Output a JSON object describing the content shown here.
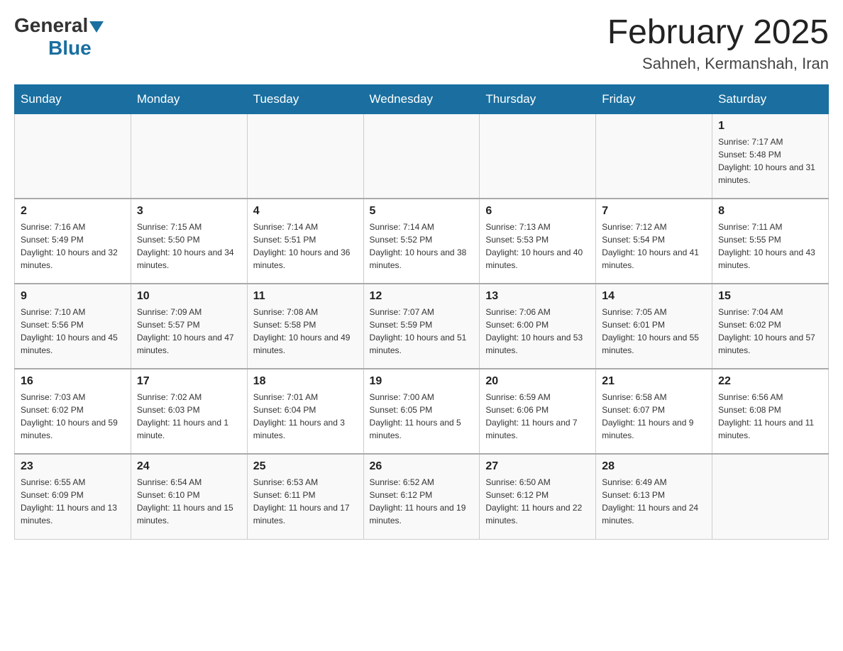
{
  "header": {
    "logo_general": "General",
    "logo_blue": "Blue",
    "month": "February 2025",
    "location": "Sahneh, Kermanshah, Iran"
  },
  "days_of_week": [
    "Sunday",
    "Monday",
    "Tuesday",
    "Wednesday",
    "Thursday",
    "Friday",
    "Saturday"
  ],
  "weeks": [
    [
      {
        "day": "",
        "sunrise": "",
        "sunset": "",
        "daylight": ""
      },
      {
        "day": "",
        "sunrise": "",
        "sunset": "",
        "daylight": ""
      },
      {
        "day": "",
        "sunrise": "",
        "sunset": "",
        "daylight": ""
      },
      {
        "day": "",
        "sunrise": "",
        "sunset": "",
        "daylight": ""
      },
      {
        "day": "",
        "sunrise": "",
        "sunset": "",
        "daylight": ""
      },
      {
        "day": "",
        "sunrise": "",
        "sunset": "",
        "daylight": ""
      },
      {
        "day": "1",
        "sunrise": "Sunrise: 7:17 AM",
        "sunset": "Sunset: 5:48 PM",
        "daylight": "Daylight: 10 hours and 31 minutes."
      }
    ],
    [
      {
        "day": "2",
        "sunrise": "Sunrise: 7:16 AM",
        "sunset": "Sunset: 5:49 PM",
        "daylight": "Daylight: 10 hours and 32 minutes."
      },
      {
        "day": "3",
        "sunrise": "Sunrise: 7:15 AM",
        "sunset": "Sunset: 5:50 PM",
        "daylight": "Daylight: 10 hours and 34 minutes."
      },
      {
        "day": "4",
        "sunrise": "Sunrise: 7:14 AM",
        "sunset": "Sunset: 5:51 PM",
        "daylight": "Daylight: 10 hours and 36 minutes."
      },
      {
        "day": "5",
        "sunrise": "Sunrise: 7:14 AM",
        "sunset": "Sunset: 5:52 PM",
        "daylight": "Daylight: 10 hours and 38 minutes."
      },
      {
        "day": "6",
        "sunrise": "Sunrise: 7:13 AM",
        "sunset": "Sunset: 5:53 PM",
        "daylight": "Daylight: 10 hours and 40 minutes."
      },
      {
        "day": "7",
        "sunrise": "Sunrise: 7:12 AM",
        "sunset": "Sunset: 5:54 PM",
        "daylight": "Daylight: 10 hours and 41 minutes."
      },
      {
        "day": "8",
        "sunrise": "Sunrise: 7:11 AM",
        "sunset": "Sunset: 5:55 PM",
        "daylight": "Daylight: 10 hours and 43 minutes."
      }
    ],
    [
      {
        "day": "9",
        "sunrise": "Sunrise: 7:10 AM",
        "sunset": "Sunset: 5:56 PM",
        "daylight": "Daylight: 10 hours and 45 minutes."
      },
      {
        "day": "10",
        "sunrise": "Sunrise: 7:09 AM",
        "sunset": "Sunset: 5:57 PM",
        "daylight": "Daylight: 10 hours and 47 minutes."
      },
      {
        "day": "11",
        "sunrise": "Sunrise: 7:08 AM",
        "sunset": "Sunset: 5:58 PM",
        "daylight": "Daylight: 10 hours and 49 minutes."
      },
      {
        "day": "12",
        "sunrise": "Sunrise: 7:07 AM",
        "sunset": "Sunset: 5:59 PM",
        "daylight": "Daylight: 10 hours and 51 minutes."
      },
      {
        "day": "13",
        "sunrise": "Sunrise: 7:06 AM",
        "sunset": "Sunset: 6:00 PM",
        "daylight": "Daylight: 10 hours and 53 minutes."
      },
      {
        "day": "14",
        "sunrise": "Sunrise: 7:05 AM",
        "sunset": "Sunset: 6:01 PM",
        "daylight": "Daylight: 10 hours and 55 minutes."
      },
      {
        "day": "15",
        "sunrise": "Sunrise: 7:04 AM",
        "sunset": "Sunset: 6:02 PM",
        "daylight": "Daylight: 10 hours and 57 minutes."
      }
    ],
    [
      {
        "day": "16",
        "sunrise": "Sunrise: 7:03 AM",
        "sunset": "Sunset: 6:02 PM",
        "daylight": "Daylight: 10 hours and 59 minutes."
      },
      {
        "day": "17",
        "sunrise": "Sunrise: 7:02 AM",
        "sunset": "Sunset: 6:03 PM",
        "daylight": "Daylight: 11 hours and 1 minute."
      },
      {
        "day": "18",
        "sunrise": "Sunrise: 7:01 AM",
        "sunset": "Sunset: 6:04 PM",
        "daylight": "Daylight: 11 hours and 3 minutes."
      },
      {
        "day": "19",
        "sunrise": "Sunrise: 7:00 AM",
        "sunset": "Sunset: 6:05 PM",
        "daylight": "Daylight: 11 hours and 5 minutes."
      },
      {
        "day": "20",
        "sunrise": "Sunrise: 6:59 AM",
        "sunset": "Sunset: 6:06 PM",
        "daylight": "Daylight: 11 hours and 7 minutes."
      },
      {
        "day": "21",
        "sunrise": "Sunrise: 6:58 AM",
        "sunset": "Sunset: 6:07 PM",
        "daylight": "Daylight: 11 hours and 9 minutes."
      },
      {
        "day": "22",
        "sunrise": "Sunrise: 6:56 AM",
        "sunset": "Sunset: 6:08 PM",
        "daylight": "Daylight: 11 hours and 11 minutes."
      }
    ],
    [
      {
        "day": "23",
        "sunrise": "Sunrise: 6:55 AM",
        "sunset": "Sunset: 6:09 PM",
        "daylight": "Daylight: 11 hours and 13 minutes."
      },
      {
        "day": "24",
        "sunrise": "Sunrise: 6:54 AM",
        "sunset": "Sunset: 6:10 PM",
        "daylight": "Daylight: 11 hours and 15 minutes."
      },
      {
        "day": "25",
        "sunrise": "Sunrise: 6:53 AM",
        "sunset": "Sunset: 6:11 PM",
        "daylight": "Daylight: 11 hours and 17 minutes."
      },
      {
        "day": "26",
        "sunrise": "Sunrise: 6:52 AM",
        "sunset": "Sunset: 6:12 PM",
        "daylight": "Daylight: 11 hours and 19 minutes."
      },
      {
        "day": "27",
        "sunrise": "Sunrise: 6:50 AM",
        "sunset": "Sunset: 6:12 PM",
        "daylight": "Daylight: 11 hours and 22 minutes."
      },
      {
        "day": "28",
        "sunrise": "Sunrise: 6:49 AM",
        "sunset": "Sunset: 6:13 PM",
        "daylight": "Daylight: 11 hours and 24 minutes."
      },
      {
        "day": "",
        "sunrise": "",
        "sunset": "",
        "daylight": ""
      }
    ]
  ]
}
